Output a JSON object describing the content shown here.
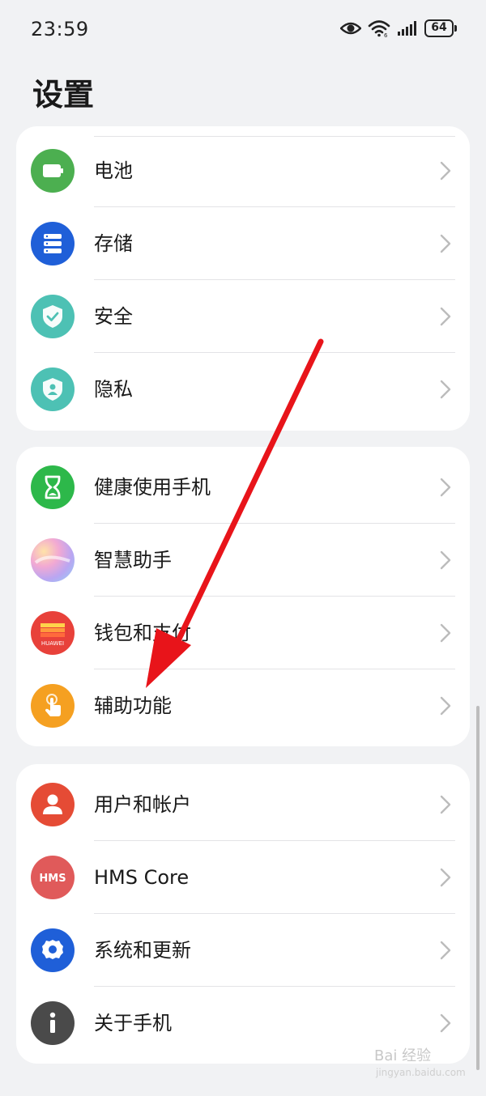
{
  "status_bar": {
    "time": "23:59",
    "battery": "64",
    "icons": [
      "eye-icon",
      "wifi-icon",
      "signal-icon",
      "battery-icon"
    ]
  },
  "page": {
    "title": "设置"
  },
  "groups": [
    {
      "items": [
        {
          "label": "电池",
          "icon": "battery-icon",
          "color": "#4caf50"
        },
        {
          "label": "存储",
          "icon": "storage-icon",
          "color": "#1f5fd8"
        },
        {
          "label": "安全",
          "icon": "shield-check-icon",
          "color": "#4dc1b4"
        },
        {
          "label": "隐私",
          "icon": "privacy-shield-icon",
          "color": "#4dc1b4"
        }
      ]
    },
    {
      "items": [
        {
          "label": "健康使用手机",
          "icon": "hourglass-icon",
          "color": "#2db84a"
        },
        {
          "label": "智慧助手",
          "icon": "assistant-orb-icon",
          "color": "#c9a6f0"
        },
        {
          "label": "钱包和支付",
          "icon": "wallet-icon",
          "color": "#e8413a",
          "badge": "HUAWEI"
        },
        {
          "label": "辅助功能",
          "icon": "hand-tap-icon",
          "color": "#f5a021"
        }
      ]
    },
    {
      "items": [
        {
          "label": "用户和帐户",
          "icon": "user-icon",
          "color": "#e54b35"
        },
        {
          "label": "HMS Core",
          "icon": "hms-icon",
          "color": "#e05a5a",
          "badge": "HMS"
        },
        {
          "label": "系统和更新",
          "icon": "gear-icon",
          "color": "#1f5fd8"
        },
        {
          "label": "关于手机",
          "icon": "info-icon",
          "color": "#4a4a4a"
        }
      ]
    }
  ],
  "watermark": {
    "text": "Bai 经验",
    "sub": "jingyan.baidu.com"
  },
  "annotation": {
    "color": "#e8141a"
  }
}
